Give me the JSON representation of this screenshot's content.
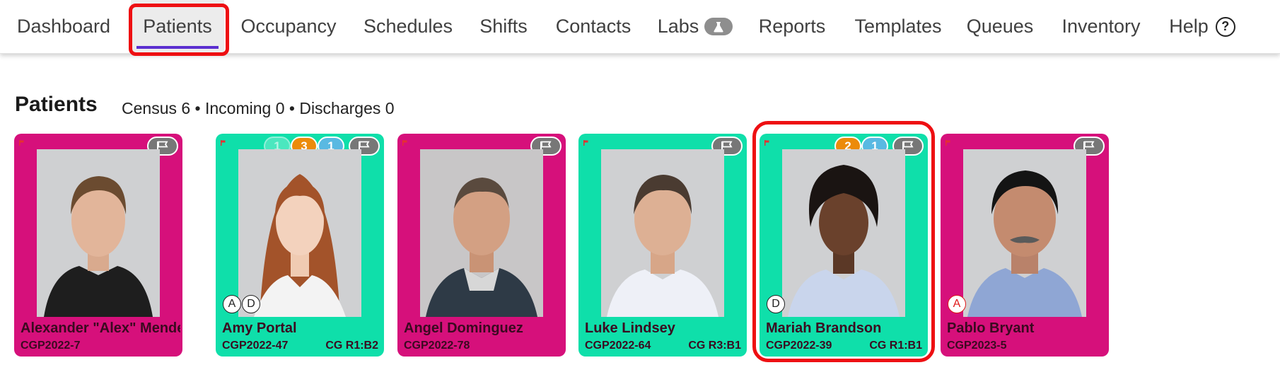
{
  "nav": {
    "items": [
      {
        "label": "Dashboard",
        "active": false
      },
      {
        "label": "Patients",
        "active": true
      },
      {
        "label": "Occupancy",
        "active": false
      },
      {
        "label": "Schedules",
        "active": false
      },
      {
        "label": "Shifts",
        "active": false
      },
      {
        "label": "Contacts",
        "active": false
      },
      {
        "label": "Labs",
        "active": false,
        "icon": "flask-icon"
      },
      {
        "label": "Reports",
        "active": false
      },
      {
        "label": "Templates",
        "active": false
      },
      {
        "label": "Queues",
        "active": false
      },
      {
        "label": "Inventory",
        "active": false
      },
      {
        "label": "Help",
        "active": false,
        "icon": "help-circle-icon",
        "icon_glyph": "?"
      }
    ]
  },
  "header": {
    "title": "Patients",
    "census": "Census 6 • Incoming 0 • Discharges 0"
  },
  "colors": {
    "magenta_card": "#d6107b",
    "teal_card": "#0fdfaa",
    "active_underline": "#5b2fd0",
    "highlight_frame": "#ee0f12",
    "badge_orange": "#ec8b0b",
    "badge_blue": "#59b9e2"
  },
  "patients": [
    {
      "name": "Alexander \"Alex\" Mendez",
      "id": "CGP2022-7",
      "bed": "",
      "color": "magenta",
      "badges": [],
      "markers": []
    },
    {
      "name": "Amy Portal",
      "id": "CGP2022-47",
      "bed": "CG R1:B2",
      "color": "teal",
      "badges": [
        "1",
        "3",
        "1"
      ],
      "markers": [
        "A",
        "D"
      ]
    },
    {
      "name": "Angel Dominguez",
      "id": "CGP2022-78",
      "bed": "",
      "color": "magenta",
      "badges": [],
      "markers": []
    },
    {
      "name": "Luke Lindsey",
      "id": "CGP2022-64",
      "bed": "CG R3:B1",
      "color": "teal",
      "badges": [],
      "markers": []
    },
    {
      "name": "Mariah Brandson",
      "id": "CGP2022-39",
      "bed": "CG R1:B1",
      "color": "teal",
      "badges": [
        "2",
        "1"
      ],
      "markers": [
        "D"
      ]
    },
    {
      "name": "Pablo Bryant",
      "id": "CGP2023-5",
      "bed": "",
      "color": "magenta",
      "badges": [],
      "markers": [
        "A"
      ]
    }
  ]
}
